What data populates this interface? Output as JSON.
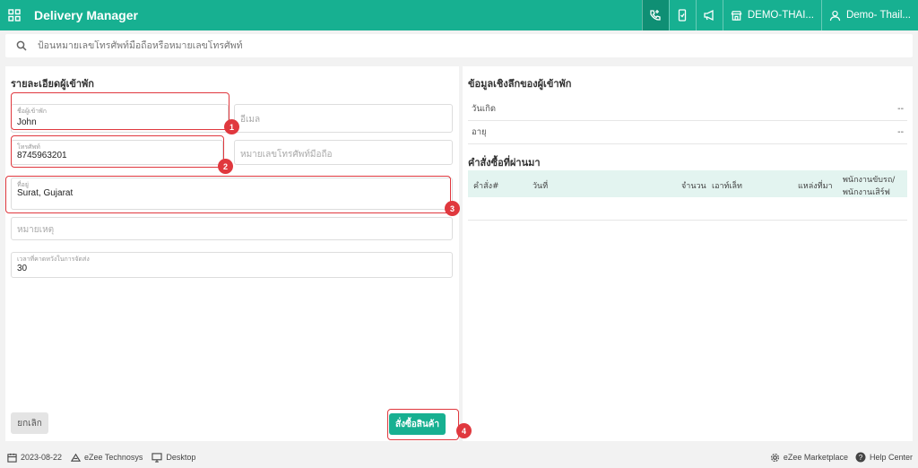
{
  "app": {
    "title": "Delivery Manager"
  },
  "topbar": {
    "property": "DEMO-THAI...",
    "user": "Demo- Thail..."
  },
  "search": {
    "placeholder": "ป้อนหมายเลขโทรศัพท์มือถือหรือหมายเลขโทรศัพท์"
  },
  "guest_details": {
    "title": "รายละเอียดผู้เข้าพัก",
    "name_label": "ชื่อผู้เข้าพัก",
    "name_value": "John",
    "email_placeholder": "อีเมล",
    "phone_label": "โทรศัพท์",
    "phone_value": "8745963201",
    "mobile_placeholder": "หมายเลขโทรศัพท์มือถือ",
    "address_label": "ที่อยู่",
    "address_value": "Surat, Gujarat",
    "remark_placeholder": "หมายเหตุ",
    "delivery_time_label": "เวลาที่คาดหวังในการจัดส่ง",
    "delivery_time_value": "30",
    "cancel_label": "ยกเลิก",
    "order_label": "สั่งซื้อสินค้า"
  },
  "markers": [
    "1",
    "2",
    "3",
    "4"
  ],
  "guest_insight": {
    "title": "ข้อมูลเชิงลึกของผู้เข้าพัก",
    "rows": [
      {
        "label": "วันเกิด",
        "value": "--"
      },
      {
        "label": "อายุ",
        "value": "--"
      }
    ]
  },
  "past_orders": {
    "title": "คำสั่งซื้อที่ผ่านมา",
    "columns": {
      "order": "คำสั่ง#",
      "date": "วันที่",
      "amount": "จำนวน",
      "outlet": "เอาท์เล็ท",
      "source": "แหล่งที่มา",
      "staff_line1": "พนักงานขับรถ/",
      "staff_line2": "พนักงานเสิร์ฟ"
    }
  },
  "footer": {
    "date": "2023-08-22",
    "company": "eZee Technosys",
    "device": "Desktop",
    "marketplace": "eZee Marketplace",
    "help": "Help Center"
  },
  "colors": {
    "accent": "#17b091",
    "highlight": "#e0383e"
  }
}
